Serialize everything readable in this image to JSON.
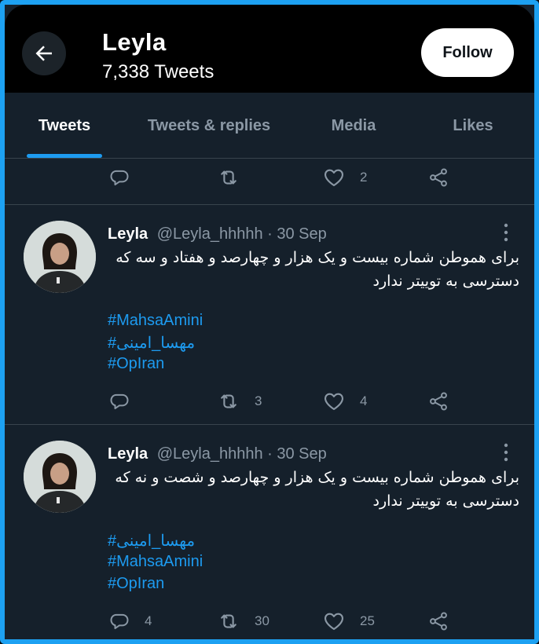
{
  "header": {
    "profile_name": "Leyla",
    "tweet_count": "7,338 Tweets",
    "follow_label": "Follow"
  },
  "tabs": [
    {
      "label": "Tweets",
      "active": true
    },
    {
      "label": "Tweets & replies",
      "active": false
    },
    {
      "label": "Media",
      "active": false
    },
    {
      "label": "Likes",
      "active": false
    }
  ],
  "top_actions": {
    "replies": "",
    "retweets": "",
    "likes": "2"
  },
  "tweets": [
    {
      "name": "Leyla",
      "handle": "@Leyla_hhhhh",
      "date": "· 30 Sep",
      "text": "برای هموطن شماره بیست و یک هزار و چهارصد و هفتاد و سه که دسترسی به توییتر ندارد",
      "hashtags": [
        "#MahsaAmini",
        "#مهسا_امینی",
        "#OpIran"
      ],
      "replies": "",
      "retweets": "3",
      "likes": "4"
    },
    {
      "name": "Leyla",
      "handle": "@Leyla_hhhhh",
      "date": "· 30 Sep",
      "text": "برای هموطن شماره بیست و یک هزار و چهارصد و شصت و نه که دسترسی به توییتر ندارد",
      "hashtags": [
        "#مهسا_امینی",
        "#MahsaAmini",
        "#OpIran"
      ],
      "replies": "4",
      "retweets": "30",
      "likes": "25"
    }
  ],
  "colors": {
    "accent": "#1d9bf0",
    "background": "#15202b",
    "header_bg": "#000000",
    "muted_text": "#8b98a5",
    "frame_border": "#1da1f2"
  },
  "icons": {
    "back": "arrow-left-icon",
    "reply": "speech-bubble-icon",
    "retweet": "retweet-arrows-icon",
    "like": "heart-icon",
    "share": "share-nodes-icon",
    "more": "vertical-dots-icon"
  }
}
